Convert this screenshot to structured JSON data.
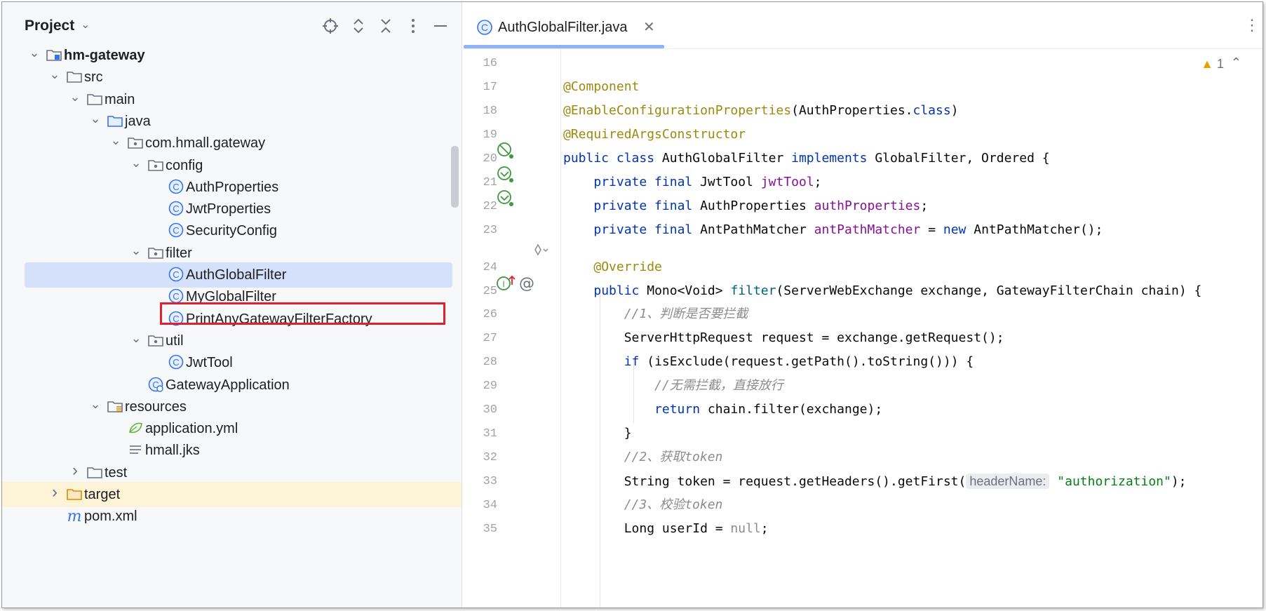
{
  "project_panel": {
    "title": "Project",
    "tree": [
      {
        "label": "hm-gateway",
        "level": 0,
        "expanded": true,
        "icon": "module-folder-icon"
      },
      {
        "label": "src",
        "level": 1,
        "expanded": true,
        "icon": "folder-icon"
      },
      {
        "label": "main",
        "level": 2,
        "expanded": true,
        "icon": "folder-icon"
      },
      {
        "label": "java",
        "level": 3,
        "expanded": true,
        "icon": "source-folder-icon"
      },
      {
        "label": "com.hmall.gateway",
        "level": 4,
        "expanded": true,
        "icon": "package-icon"
      },
      {
        "label": "config",
        "level": 5,
        "expanded": true,
        "icon": "package-icon"
      },
      {
        "label": "AuthProperties",
        "level": 6,
        "icon": "class-icon"
      },
      {
        "label": "JwtProperties",
        "level": 6,
        "icon": "class-icon"
      },
      {
        "label": "SecurityConfig",
        "level": 6,
        "icon": "class-icon"
      },
      {
        "label": "filter",
        "level": 5,
        "expanded": true,
        "icon": "package-icon"
      },
      {
        "label": "AuthGlobalFilter",
        "level": 6,
        "icon": "class-icon",
        "selected": true
      },
      {
        "label": "MyGlobalFilter",
        "level": 6,
        "icon": "class-icon"
      },
      {
        "label": "PrintAnyGatewayFilterFactory",
        "level": 6,
        "icon": "class-icon"
      },
      {
        "label": "util",
        "level": 5,
        "expanded": true,
        "icon": "package-icon"
      },
      {
        "label": "JwtTool",
        "level": 6,
        "icon": "class-icon"
      },
      {
        "label": "GatewayApplication",
        "level": 5,
        "icon": "spring-boot-class-icon"
      },
      {
        "label": "resources",
        "level": 3,
        "expanded": true,
        "icon": "resources-folder-icon"
      },
      {
        "label": "application.yml",
        "level": 4,
        "icon": "yaml-file-icon"
      },
      {
        "label": "hmall.jks",
        "level": 4,
        "icon": "text-file-icon"
      },
      {
        "label": "test",
        "level": 2,
        "expanded": false,
        "icon": "folder-icon"
      },
      {
        "label": "target",
        "level": 1,
        "expanded": false,
        "icon": "excluded-folder-icon",
        "highlight": true
      },
      {
        "label": "pom.xml",
        "level": 1,
        "icon": "maven-icon"
      }
    ]
  },
  "editor": {
    "tab_label": "AuthGlobalFilter.java",
    "warning_count": "1",
    "lines": [
      {
        "n": "16",
        "html": ""
      },
      {
        "n": "17",
        "html": "<span class=\"ann\">@Component</span>"
      },
      {
        "n": "18",
        "html": "<span class=\"ann\">@EnableConfigurationProperties</span>(AuthProperties.<span class=\"kw\">class</span>)"
      },
      {
        "n": "19",
        "html": "<span class=\"ann\">@RequiredArgsConstructor</span>"
      },
      {
        "n": "20",
        "html": "<span class=\"kw\">public class</span> AuthGlobalFilter <span class=\"kw\">implements</span> GlobalFilter, Ordered {"
      },
      {
        "n": "21",
        "html": "    <span class=\"kw\">private final</span> JwtTool <span class=\"fld\">jwtTool</span>;"
      },
      {
        "n": "22",
        "html": "    <span class=\"kw\">private final</span> AuthProperties <span class=\"fld\">authProperties</span>;"
      },
      {
        "n": "23",
        "html": "    <span class=\"kw\">private final</span> AntPathMatcher <span class=\"fld\">antPathMatcher</span> = <span class=\"kw\">new</span> AntPathMatcher();"
      },
      {
        "n": "24",
        "html": "    <span class=\"ann\">@Override</span>"
      },
      {
        "n": "25",
        "html": "    <span class=\"kw\">public</span> Mono&lt;Void&gt; <span class=\"fn\">filter</span>(ServerWebExchange exchange, GatewayFilterChain chain) {"
      },
      {
        "n": "26",
        "html": "        <span class=\"cm\">//1、判断是否要拦截</span>"
      },
      {
        "n": "27",
        "html": "        ServerHttpRequest request = exchange.getRequest();"
      },
      {
        "n": "28",
        "html": "        <span class=\"kw\">if</span> (isExclude(request.getPath().toString())) {"
      },
      {
        "n": "29",
        "html": "            <span class=\"cm\">//无需拦截，直接放行</span>"
      },
      {
        "n": "30",
        "html": "            <span class=\"kw\">return</span> chain.filter(exchange);"
      },
      {
        "n": "31",
        "html": "        }"
      },
      {
        "n": "32",
        "html": "        <span class=\"cm\">//2、获取token</span>"
      },
      {
        "n": "33",
        "html": "        String token = request.getHeaders().getFirst(<span class=\"hint\">headerName:</span> <span class=\"str\">\"authorization\"</span>);"
      },
      {
        "n": "34",
        "html": "        <span class=\"cm\">//3、校验token</span>"
      },
      {
        "n": "35",
        "html": "        Long userId = <span class=\"nul\">null</span>;"
      }
    ]
  }
}
